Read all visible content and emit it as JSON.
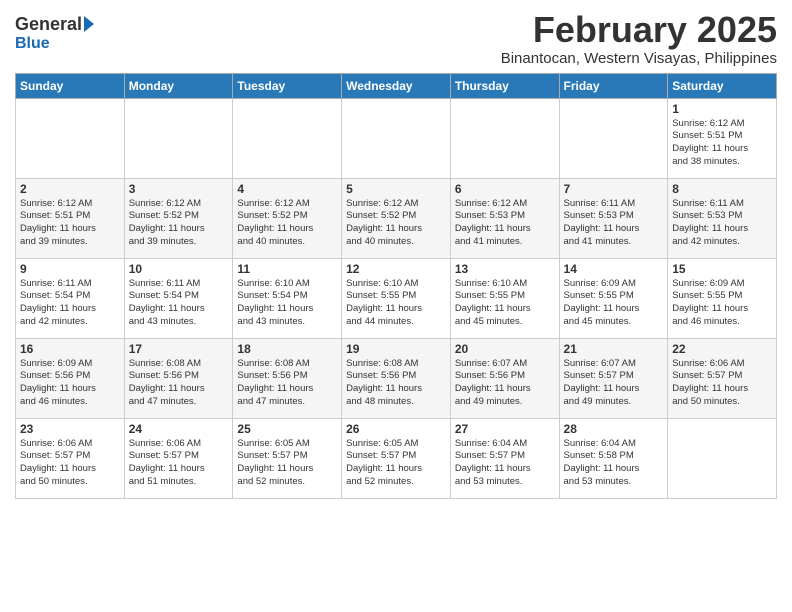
{
  "header": {
    "logo_general": "General",
    "logo_blue": "Blue",
    "month_year": "February 2025",
    "location": "Binantocan, Western Visayas, Philippines"
  },
  "weekdays": [
    "Sunday",
    "Monday",
    "Tuesday",
    "Wednesday",
    "Thursday",
    "Friday",
    "Saturday"
  ],
  "weeks": [
    [
      {
        "day": "",
        "info": ""
      },
      {
        "day": "",
        "info": ""
      },
      {
        "day": "",
        "info": ""
      },
      {
        "day": "",
        "info": ""
      },
      {
        "day": "",
        "info": ""
      },
      {
        "day": "",
        "info": ""
      },
      {
        "day": "1",
        "info": "Sunrise: 6:12 AM\nSunset: 5:51 PM\nDaylight: 11 hours\nand 38 minutes."
      }
    ],
    [
      {
        "day": "2",
        "info": "Sunrise: 6:12 AM\nSunset: 5:51 PM\nDaylight: 11 hours\nand 39 minutes."
      },
      {
        "day": "3",
        "info": "Sunrise: 6:12 AM\nSunset: 5:52 PM\nDaylight: 11 hours\nand 39 minutes."
      },
      {
        "day": "4",
        "info": "Sunrise: 6:12 AM\nSunset: 5:52 PM\nDaylight: 11 hours\nand 40 minutes."
      },
      {
        "day": "5",
        "info": "Sunrise: 6:12 AM\nSunset: 5:52 PM\nDaylight: 11 hours\nand 40 minutes."
      },
      {
        "day": "6",
        "info": "Sunrise: 6:12 AM\nSunset: 5:53 PM\nDaylight: 11 hours\nand 41 minutes."
      },
      {
        "day": "7",
        "info": "Sunrise: 6:11 AM\nSunset: 5:53 PM\nDaylight: 11 hours\nand 41 minutes."
      },
      {
        "day": "8",
        "info": "Sunrise: 6:11 AM\nSunset: 5:53 PM\nDaylight: 11 hours\nand 42 minutes."
      }
    ],
    [
      {
        "day": "9",
        "info": "Sunrise: 6:11 AM\nSunset: 5:54 PM\nDaylight: 11 hours\nand 42 minutes."
      },
      {
        "day": "10",
        "info": "Sunrise: 6:11 AM\nSunset: 5:54 PM\nDaylight: 11 hours\nand 43 minutes."
      },
      {
        "day": "11",
        "info": "Sunrise: 6:10 AM\nSunset: 5:54 PM\nDaylight: 11 hours\nand 43 minutes."
      },
      {
        "day": "12",
        "info": "Sunrise: 6:10 AM\nSunset: 5:55 PM\nDaylight: 11 hours\nand 44 minutes."
      },
      {
        "day": "13",
        "info": "Sunrise: 6:10 AM\nSunset: 5:55 PM\nDaylight: 11 hours\nand 45 minutes."
      },
      {
        "day": "14",
        "info": "Sunrise: 6:09 AM\nSunset: 5:55 PM\nDaylight: 11 hours\nand 45 minutes."
      },
      {
        "day": "15",
        "info": "Sunrise: 6:09 AM\nSunset: 5:55 PM\nDaylight: 11 hours\nand 46 minutes."
      }
    ],
    [
      {
        "day": "16",
        "info": "Sunrise: 6:09 AM\nSunset: 5:56 PM\nDaylight: 11 hours\nand 46 minutes."
      },
      {
        "day": "17",
        "info": "Sunrise: 6:08 AM\nSunset: 5:56 PM\nDaylight: 11 hours\nand 47 minutes."
      },
      {
        "day": "18",
        "info": "Sunrise: 6:08 AM\nSunset: 5:56 PM\nDaylight: 11 hours\nand 47 minutes."
      },
      {
        "day": "19",
        "info": "Sunrise: 6:08 AM\nSunset: 5:56 PM\nDaylight: 11 hours\nand 48 minutes."
      },
      {
        "day": "20",
        "info": "Sunrise: 6:07 AM\nSunset: 5:56 PM\nDaylight: 11 hours\nand 49 minutes."
      },
      {
        "day": "21",
        "info": "Sunrise: 6:07 AM\nSunset: 5:57 PM\nDaylight: 11 hours\nand 49 minutes."
      },
      {
        "day": "22",
        "info": "Sunrise: 6:06 AM\nSunset: 5:57 PM\nDaylight: 11 hours\nand 50 minutes."
      }
    ],
    [
      {
        "day": "23",
        "info": "Sunrise: 6:06 AM\nSunset: 5:57 PM\nDaylight: 11 hours\nand 50 minutes."
      },
      {
        "day": "24",
        "info": "Sunrise: 6:06 AM\nSunset: 5:57 PM\nDaylight: 11 hours\nand 51 minutes."
      },
      {
        "day": "25",
        "info": "Sunrise: 6:05 AM\nSunset: 5:57 PM\nDaylight: 11 hours\nand 52 minutes."
      },
      {
        "day": "26",
        "info": "Sunrise: 6:05 AM\nSunset: 5:57 PM\nDaylight: 11 hours\nand 52 minutes."
      },
      {
        "day": "27",
        "info": "Sunrise: 6:04 AM\nSunset: 5:57 PM\nDaylight: 11 hours\nand 53 minutes."
      },
      {
        "day": "28",
        "info": "Sunrise: 6:04 AM\nSunset: 5:58 PM\nDaylight: 11 hours\nand 53 minutes."
      },
      {
        "day": "",
        "info": ""
      }
    ]
  ]
}
